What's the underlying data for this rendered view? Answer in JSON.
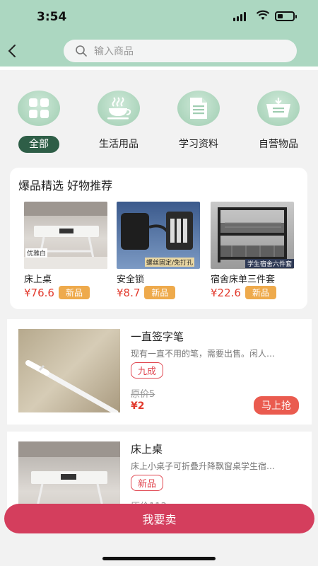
{
  "status": {
    "time": "3:54"
  },
  "search": {
    "placeholder": "输入商品"
  },
  "categories": [
    {
      "label": "全部",
      "icon": "grid-icon"
    },
    {
      "label": "生活用品",
      "icon": "coffee-cup-icon"
    },
    {
      "label": "学习资料",
      "icon": "document-icon"
    },
    {
      "label": "自营物品",
      "icon": "shopping-basket-icon"
    }
  ],
  "hot": {
    "title": "爆品精选 好物推荐",
    "products": [
      {
        "name": "床上桌",
        "price": "¥76.6",
        "tag": "新品",
        "img_text": "优雅白"
      },
      {
        "name": "安全锁",
        "price": "¥8.7",
        "tag": "新品",
        "img_text": "螺丝固定/免打孔"
      },
      {
        "name": "宿舍床单三件套",
        "price": "¥22.6",
        "tag": "新品",
        "img_text": "学生宿舍六件套"
      }
    ]
  },
  "listings": [
    {
      "title": "一直签字笔",
      "desc": "现有一直不用的笔，需要出售。闲人…",
      "condition": "九成",
      "original": "原价5",
      "price": "¥2",
      "action": "马上抢"
    },
    {
      "title": "床上桌",
      "desc": "床上小桌子可折叠升降飘窗桌学生宿…",
      "condition": "新品",
      "original": "原价113"
    }
  ],
  "sell_button": "我要卖",
  "colors": {
    "header": "#acd7c1",
    "accent_green": "#2e5e47",
    "price_red": "#e23b2e",
    "sell": "#d43e5d",
    "tag_orange": "#eeaa4c"
  }
}
